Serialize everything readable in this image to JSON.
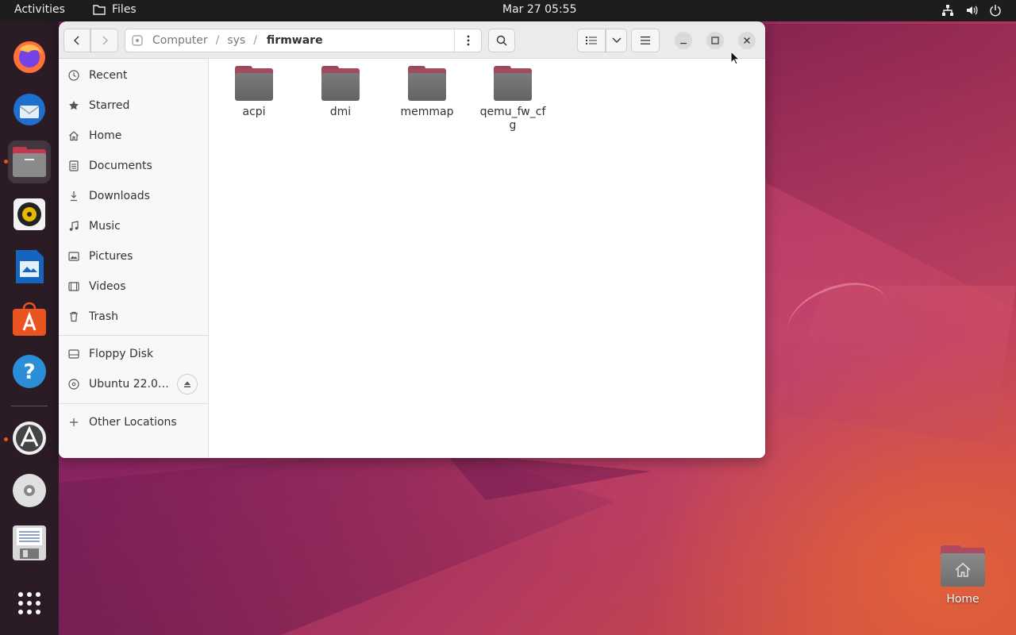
{
  "topbar": {
    "activities": "Activities",
    "app_name": "Files",
    "clock": "Mar 27  05:55"
  },
  "dock": {
    "items": [
      {
        "name": "Firefox",
        "icon": "firefox-icon"
      },
      {
        "name": "Thunderbird",
        "icon": "thunderbird-icon"
      },
      {
        "name": "Files",
        "icon": "files-icon",
        "active": true
      },
      {
        "name": "Rhythmbox",
        "icon": "rhythmbox-icon"
      },
      {
        "name": "LibreOffice Writer",
        "icon": "writer-icon"
      },
      {
        "name": "Ubuntu Software",
        "icon": "software-icon"
      },
      {
        "name": "Help",
        "icon": "help-icon"
      },
      {
        "name": "Software Updater",
        "icon": "updater-icon"
      },
      {
        "name": "CD Drive",
        "icon": "disc-icon"
      },
      {
        "name": "Floppy Disk",
        "icon": "floppy-icon"
      },
      {
        "name": "Show Applications",
        "icon": "app-grid-icon"
      }
    ]
  },
  "window": {
    "path": {
      "root": "Computer",
      "parent": "sys",
      "current": "firmware",
      "separator": "/"
    },
    "sidebar": {
      "places": [
        {
          "label": "Recent",
          "icon": "clock-icon"
        },
        {
          "label": "Starred",
          "icon": "star-icon"
        },
        {
          "label": "Home",
          "icon": "home-icon"
        },
        {
          "label": "Documents",
          "icon": "document-icon"
        },
        {
          "label": "Downloads",
          "icon": "download-icon"
        },
        {
          "label": "Music",
          "icon": "music-icon"
        },
        {
          "label": "Pictures",
          "icon": "picture-icon"
        },
        {
          "label": "Videos",
          "icon": "video-icon"
        },
        {
          "label": "Trash",
          "icon": "trash-icon"
        }
      ],
      "devices": [
        {
          "label": "Floppy Disk",
          "icon": "drive-icon"
        },
        {
          "label": "Ubuntu 22.0…",
          "icon": "disc-icon"
        }
      ],
      "other": "Other Locations"
    },
    "folders": [
      "acpi",
      "dmi",
      "memmap",
      "qemu_fw_cfg"
    ]
  },
  "desktop": {
    "home_label": "Home"
  }
}
